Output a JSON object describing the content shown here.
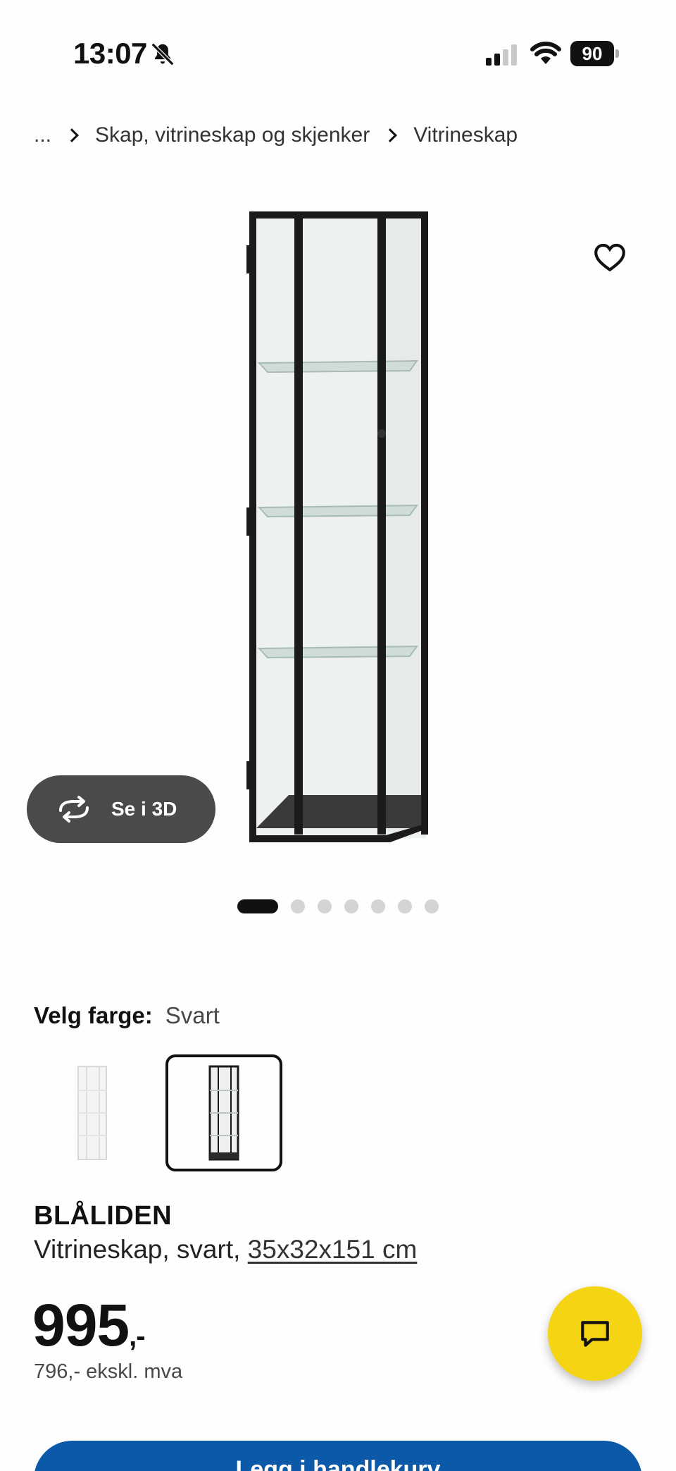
{
  "status_bar": {
    "time": "13:07",
    "battery": "90"
  },
  "breadcrumb": [
    {
      "label": "..."
    },
    {
      "label": "Skap, vitrineskap og skjenker"
    },
    {
      "label": "Vitrineskap"
    }
  ],
  "gallery": {
    "view_3d_label": "Se i 3D",
    "image_count": 7,
    "active_index": 0
  },
  "color": {
    "label": "Velg farge:",
    "selected": "Svart",
    "options": [
      "white",
      "black"
    ]
  },
  "product": {
    "name": "BLÅLIDEN",
    "description": "Vitrineskap, svart,",
    "dimensions": "35x32x151 cm",
    "price": "995",
    "price_suffix": ",-",
    "price_ex_vat": "796,- ekskl. mva"
  },
  "cart_button": {
    "label": "Legg i handlekurv"
  },
  "colors": {
    "accent_blue": "#0b59a8",
    "chat_yellow": "#f5d414",
    "pill_gray": "#4a4a4a"
  }
}
